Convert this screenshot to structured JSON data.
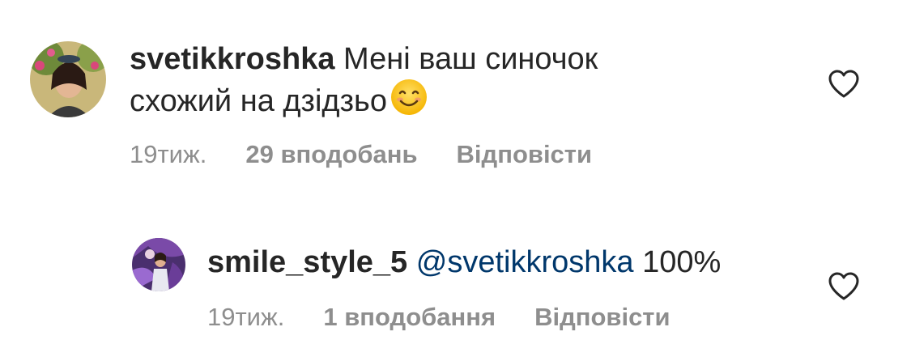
{
  "comments": [
    {
      "username": "svetikkroshka",
      "text_line1": " Мені ваш синочок",
      "text_line2": "схожий на дзідзьо",
      "emoji": "smiling-face-emoji",
      "time": "19тиж.",
      "likes": "29 вподобань",
      "reply": "Відповісти",
      "heart_icon": "heart-outline-icon"
    },
    {
      "username": "smile_style_5",
      "mention": "@svetikkroshka",
      "text": " 100%",
      "time": "19тиж.",
      "likes": "1 вподобання",
      "reply": "Відповісти",
      "heart_icon": "heart-outline-icon"
    }
  ],
  "colors": {
    "text": "#262626",
    "meta": "#8e8e8e",
    "mention": "#00376b"
  }
}
